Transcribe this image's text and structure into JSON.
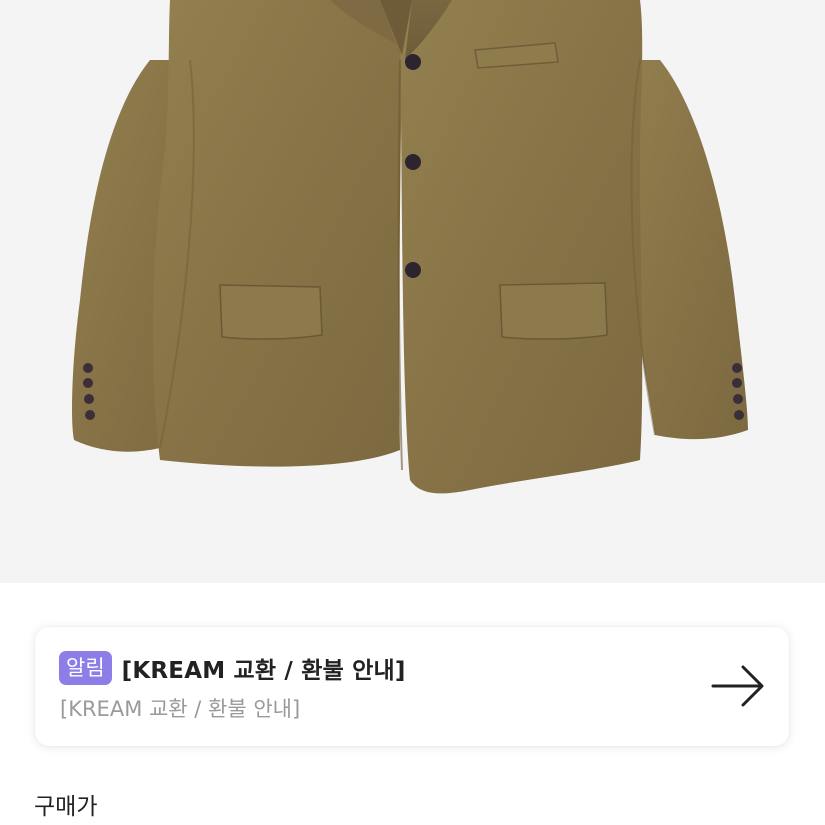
{
  "product": {
    "image_subject": "olive-brown corduroy three-button blazer"
  },
  "notice": {
    "badge": "알림",
    "title": "[KREAM 교환 / 환불 안내]",
    "subtitle": "[KREAM 교환 / 환불 안내]",
    "arrow_icon": "arrow-right-icon"
  },
  "price": {
    "label": "구매가"
  },
  "colors": {
    "badge_bg": "#8c7ee6",
    "jacket": "#8a7548"
  }
}
